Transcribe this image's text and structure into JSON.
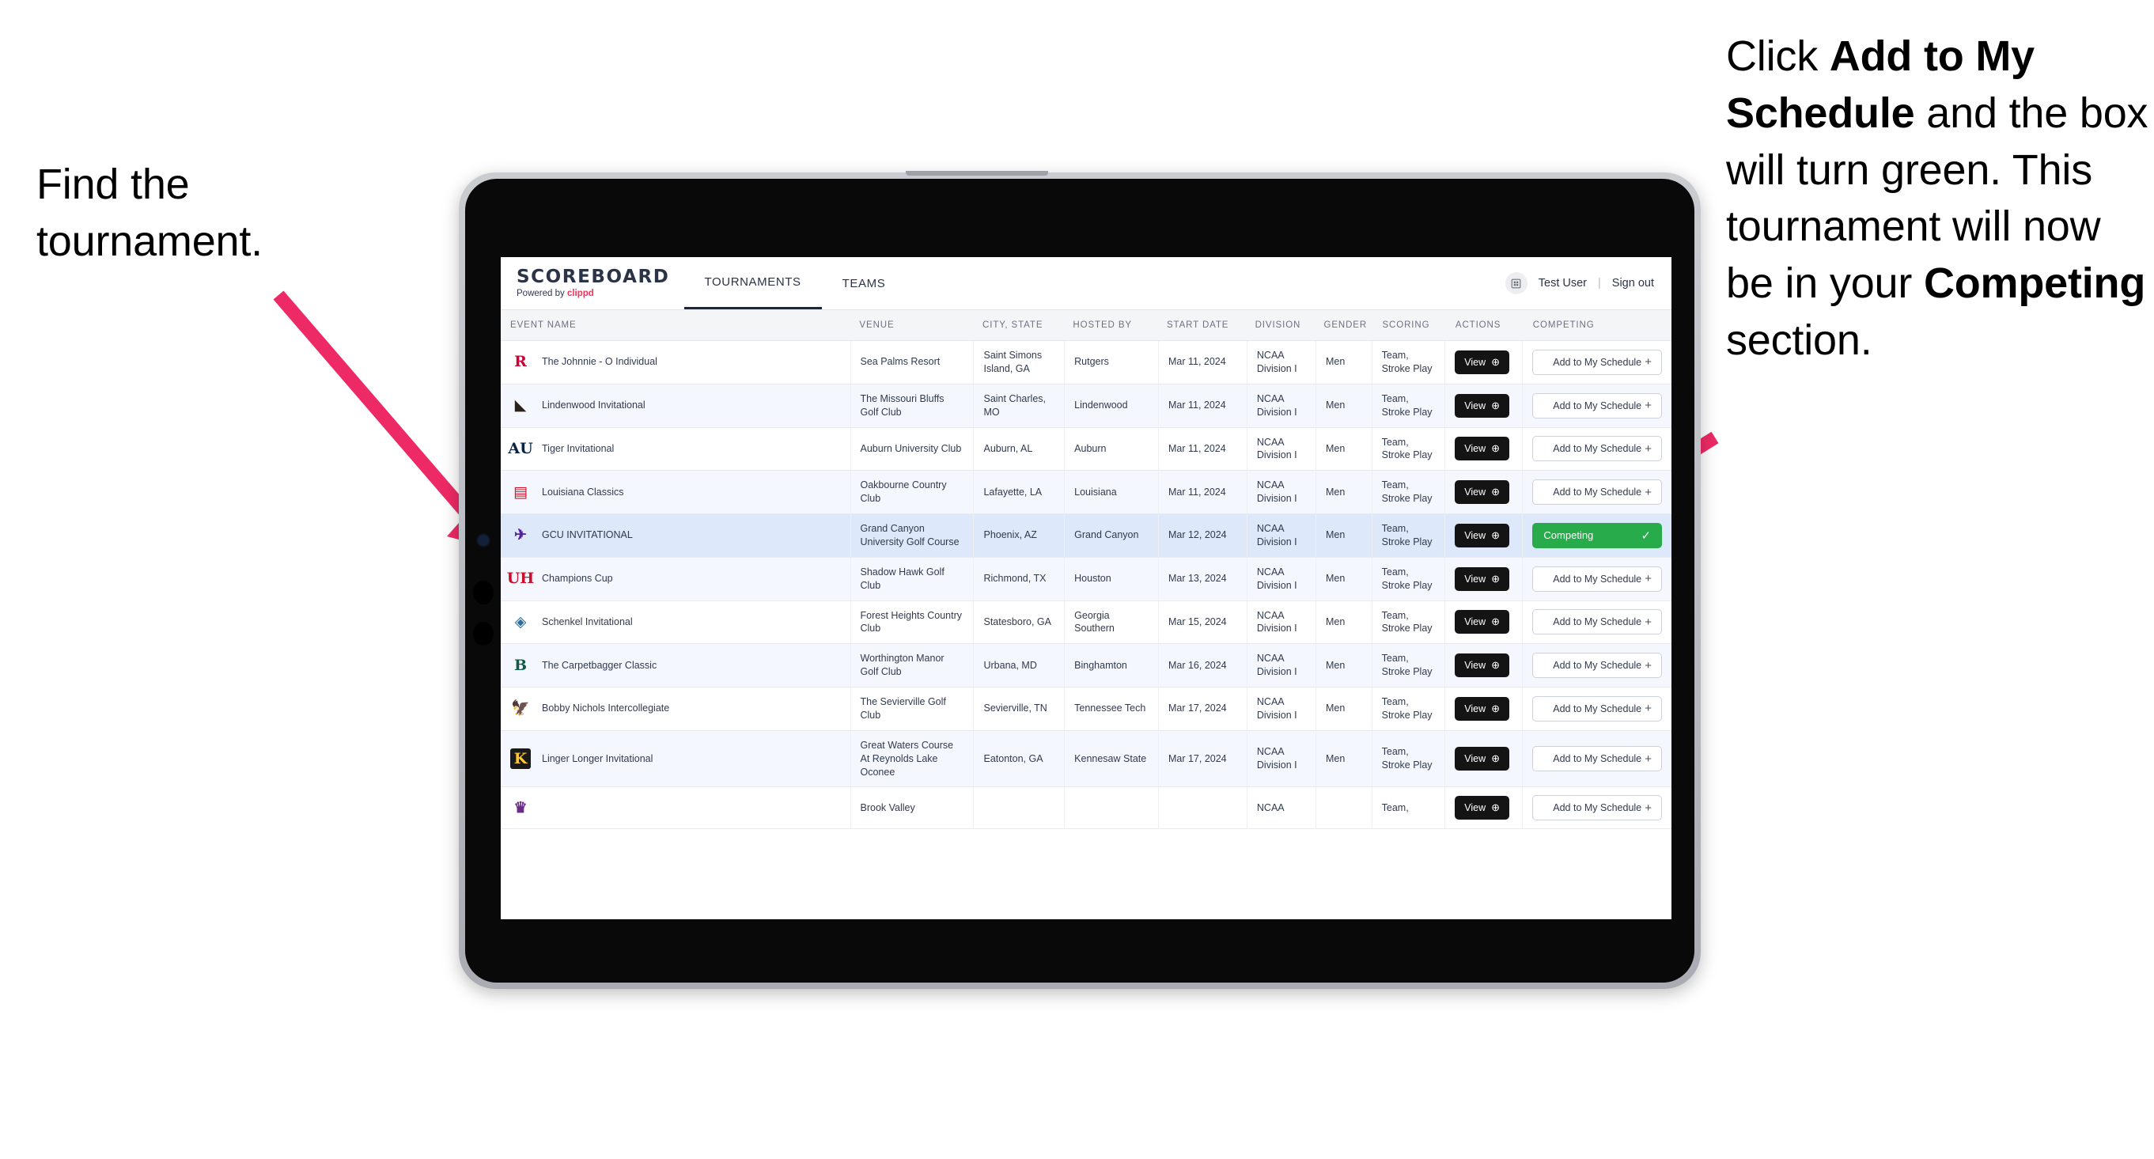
{
  "annotations": {
    "left": {
      "line1": "Find the",
      "line2": "tournament."
    },
    "right": {
      "segments": [
        {
          "t": "Click ",
          "b": false
        },
        {
          "t": "Add to My Schedule",
          "b": true
        },
        {
          "t": " and the box will turn green. This tournament will now be in your ",
          "b": false
        },
        {
          "t": "Competing",
          "b": true
        },
        {
          "t": " section.",
          "b": false
        }
      ]
    },
    "arrow_color": "#ee2a66"
  },
  "app": {
    "brand": {
      "title": "SCOREBOARD",
      "powered_prefix": "Powered by ",
      "powered_brand": "clippd"
    },
    "tabs": [
      {
        "label": "TOURNAMENTS",
        "active": true
      },
      {
        "label": "TEAMS",
        "active": false
      }
    ],
    "user": {
      "avatar_icon": "user-avatar-icon",
      "name": "Test User",
      "separator": "|",
      "signout": "Sign out"
    },
    "columns": [
      "EVENT NAME",
      "VENUE",
      "CITY, STATE",
      "HOSTED BY",
      "START DATE",
      "DIVISION",
      "GENDER",
      "SCORING",
      "ACTIONS",
      "COMPETING"
    ],
    "labels": {
      "view": "View",
      "view_icon": "arrow-right-circle-icon",
      "add": "Add to My Schedule",
      "add_icon": "plus-icon",
      "competing": "Competing",
      "competing_icon": "check-icon"
    },
    "colors": {
      "competing_green": "#27ab4b",
      "view_dark": "#141414",
      "selected_row": "#dde8fb",
      "accent_pink": "#f0325c"
    },
    "rows": [
      {
        "event": "The Johnnie - O Individual",
        "venue": "Sea Palms Resort",
        "city": "Saint Simons Island, GA",
        "host": "Rutgers",
        "date": "Mar 11, 2024",
        "division": "NCAA Division I",
        "gender": "Men",
        "scoring": "Team, Stroke Play",
        "competing": false,
        "logo": {
          "glyph": "R",
          "color": "#cc0033",
          "bg": "transparent"
        }
      },
      {
        "event": "Lindenwood Invitational",
        "venue": "The Missouri Bluffs Golf Club",
        "city": "Saint Charles, MO",
        "host": "Lindenwood",
        "date": "Mar 11, 2024",
        "division": "NCAA Division I",
        "gender": "Men",
        "scoring": "Team, Stroke Play",
        "competing": false,
        "logo": {
          "glyph": "◣",
          "color": "#2a2118",
          "bg": "transparent"
        }
      },
      {
        "event": "Tiger Invitational",
        "venue": "Auburn University Club",
        "city": "Auburn, AL",
        "host": "Auburn",
        "date": "Mar 11, 2024",
        "division": "NCAA Division I",
        "gender": "Men",
        "scoring": "Team, Stroke Play",
        "competing": false,
        "logo": {
          "glyph": "AU",
          "color": "#0c2340",
          "bg": "transparent"
        }
      },
      {
        "event": "Louisiana Classics",
        "venue": "Oakbourne Country Club",
        "city": "Lafayette, LA",
        "host": "Louisiana",
        "date": "Mar 11, 2024",
        "division": "NCAA Division I",
        "gender": "Men",
        "scoring": "Team, Stroke Play",
        "competing": false,
        "logo": {
          "glyph": "▤",
          "color": "#ce1126",
          "bg": "transparent"
        }
      },
      {
        "event": "GCU INVITATIONAL",
        "venue": "Grand Canyon University Golf Course",
        "city": "Phoenix, AZ",
        "host": "Grand Canyon",
        "date": "Mar 12, 2024",
        "division": "NCAA Division I",
        "gender": "Men",
        "scoring": "Team, Stroke Play",
        "competing": true,
        "logo": {
          "glyph": "✈",
          "color": "#522398",
          "bg": "transparent"
        }
      },
      {
        "event": "Champions Cup",
        "venue": "Shadow Hawk Golf Club",
        "city": "Richmond, TX",
        "host": "Houston",
        "date": "Mar 13, 2024",
        "division": "NCAA Division I",
        "gender": "Men",
        "scoring": "Team, Stroke Play",
        "competing": false,
        "logo": {
          "glyph": "UH",
          "color": "#c8102e",
          "bg": "transparent"
        }
      },
      {
        "event": "Schenkel Invitational",
        "venue": "Forest Heights Country Club",
        "city": "Statesboro, GA",
        "host": "Georgia Southern",
        "date": "Mar 15, 2024",
        "division": "NCAA Division I",
        "gender": "Men",
        "scoring": "Team, Stroke Play",
        "competing": false,
        "logo": {
          "glyph": "◈",
          "color": "#2c6ca0",
          "bg": "transparent"
        }
      },
      {
        "event": "The Carpetbagger Classic",
        "venue": "Worthington Manor Golf Club",
        "city": "Urbana, MD",
        "host": "Binghamton",
        "date": "Mar 16, 2024",
        "division": "NCAA Division I",
        "gender": "Men",
        "scoring": "Team, Stroke Play",
        "competing": false,
        "logo": {
          "glyph": "B",
          "color": "#0f5c4a",
          "bg": "transparent"
        }
      },
      {
        "event": "Bobby Nichols Intercollegiate",
        "venue": "The Sevierville Golf Club",
        "city": "Sevierville, TN",
        "host": "Tennessee Tech",
        "date": "Mar 17, 2024",
        "division": "NCAA Division I",
        "gender": "Men",
        "scoring": "Team, Stroke Play",
        "competing": false,
        "logo": {
          "glyph": "🦅",
          "color": "#6b2a84",
          "bg": "transparent"
        }
      },
      {
        "event": "Linger Longer Invitational",
        "venue": "Great Waters Course At Reynolds Lake Oconee",
        "city": "Eatonton, GA",
        "host": "Kennesaw State",
        "date": "Mar 17, 2024",
        "division": "NCAA Division I",
        "gender": "Men",
        "scoring": "Team, Stroke Play",
        "competing": false,
        "logo": {
          "glyph": "K",
          "color": "#ffc629",
          "bg": "#1a1a1a"
        }
      },
      {
        "event": "",
        "venue": "Brook Valley",
        "city": "",
        "host": "",
        "date": "",
        "division": "NCAA",
        "gender": "",
        "scoring": "Team,",
        "competing": false,
        "partial": true,
        "logo": {
          "glyph": "♛",
          "color": "#6b2a84",
          "bg": "transparent"
        }
      }
    ]
  }
}
